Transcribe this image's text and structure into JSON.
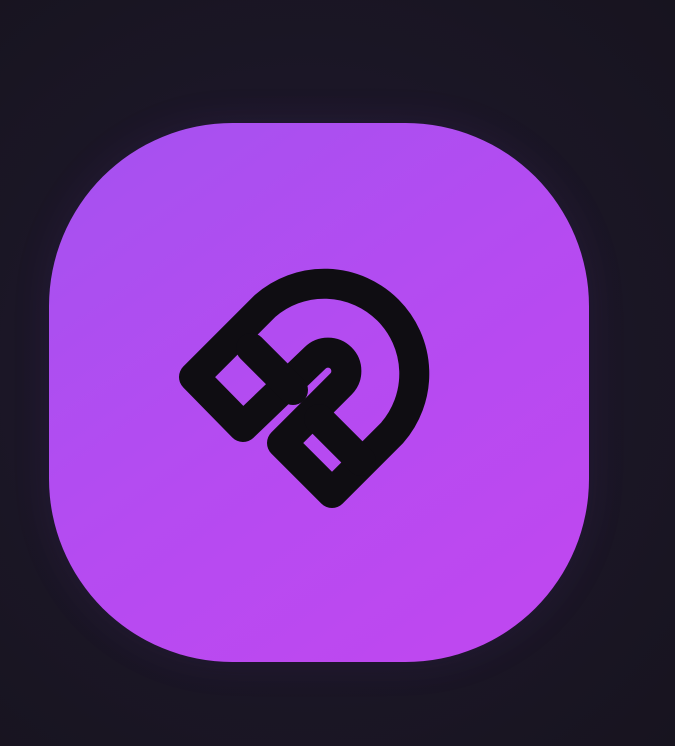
{
  "icon": {
    "name": "magnet-icon",
    "background_gradient": [
      "#a552f0",
      "#c147f0"
    ],
    "stroke_color": "#0f0d12",
    "page_background": "#1b1626"
  }
}
